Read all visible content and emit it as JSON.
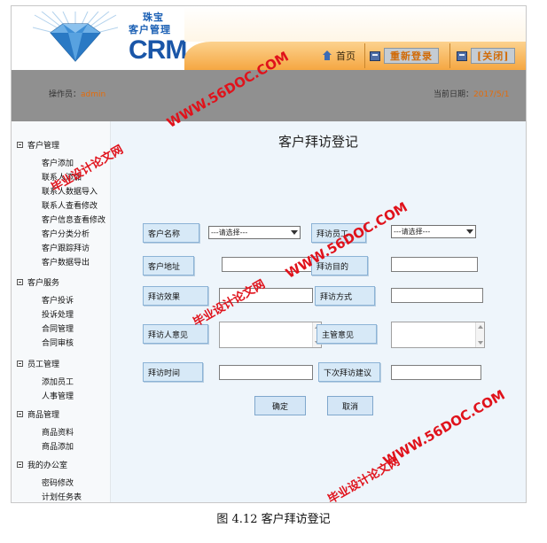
{
  "logo": {
    "line1": "珠宝",
    "line2": "客户管理",
    "crm": "CRM"
  },
  "topnav": {
    "home": "首页",
    "relogin": "重新登录",
    "close": "[关闭]"
  },
  "infobar": {
    "operator_label": "操作员：",
    "operator_value": "admin",
    "date_label": "当前日期：",
    "date_value": "2017/5/1"
  },
  "sidebar": {
    "groups": [
      {
        "label": "客户管理",
        "items": [
          "客户添加",
          "联系人添加",
          "联系人数据导入",
          "联系人查看修改",
          "客户信息查看修改",
          "客户分类分析",
          "客户跟踪拜访",
          "客户数据导出"
        ]
      },
      {
        "label": "客户服务",
        "items": [
          "客户投诉",
          "投诉处理",
          "合同管理",
          "合同审核"
        ]
      },
      {
        "label": "员工管理",
        "items": [
          "添加员工",
          "人事管理"
        ]
      },
      {
        "label": "商品管理",
        "items": [
          "商品资料",
          "商品添加"
        ]
      },
      {
        "label": "我的办公室",
        "items": [
          "密码修改",
          "计划任务表"
        ]
      }
    ]
  },
  "form": {
    "title": "客户拜访登记",
    "customer_name_label": "客户名称",
    "customer_name_value": "---请选择---",
    "visitor_employee_label": "拜访员工",
    "visitor_employee_value": "---请选择---",
    "customer_address_label": "客户地址",
    "visit_purpose_label": "拜访目的",
    "visit_effect_label": "拜访效果",
    "visit_method_label": "拜访方式",
    "visitor_opinion_label": "拜访人意见",
    "supervisor_opinion_label": "主管意见",
    "visit_time_label": "拜访时间",
    "next_visit_label": "下次拜访建议",
    "confirm_label": "确定",
    "cancel_label": "取消"
  },
  "watermark": {
    "site": "WWW.56DOC.COM",
    "name": "毕业设计论文网",
    "color": "#e0121b"
  },
  "caption": "图 4.12 客户拜访登记"
}
